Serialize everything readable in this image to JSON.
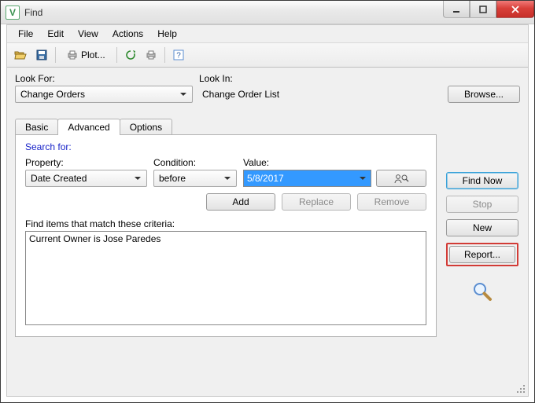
{
  "window_title": "Find",
  "menu": {
    "file": "File",
    "edit": "Edit",
    "view": "View",
    "actions": "Actions",
    "help": "Help"
  },
  "toolbar": {
    "plot_label": "Plot..."
  },
  "lookfor_label": "Look For:",
  "lookin_label": "Look In:",
  "lookfor_value": "Change Orders",
  "lookin_value": "Change Order List",
  "browse_label": "Browse...",
  "tabs": {
    "basic": "Basic",
    "advanced": "Advanced",
    "options": "Options"
  },
  "advanced": {
    "search_for_label": "Search for:",
    "property_label": "Property:",
    "condition_label": "Condition:",
    "value_label": "Value:",
    "property_value": "Date Created",
    "condition_value": "before",
    "value_value": "5/8/2017",
    "add_label": "Add",
    "replace_label": "Replace",
    "remove_label": "Remove",
    "criteria_label": "Find items that match these criteria:",
    "criteria_item": "Current Owner is Jose Paredes"
  },
  "actions": {
    "find_now": "Find Now",
    "stop": "Stop",
    "new": "New",
    "report": "Report..."
  }
}
